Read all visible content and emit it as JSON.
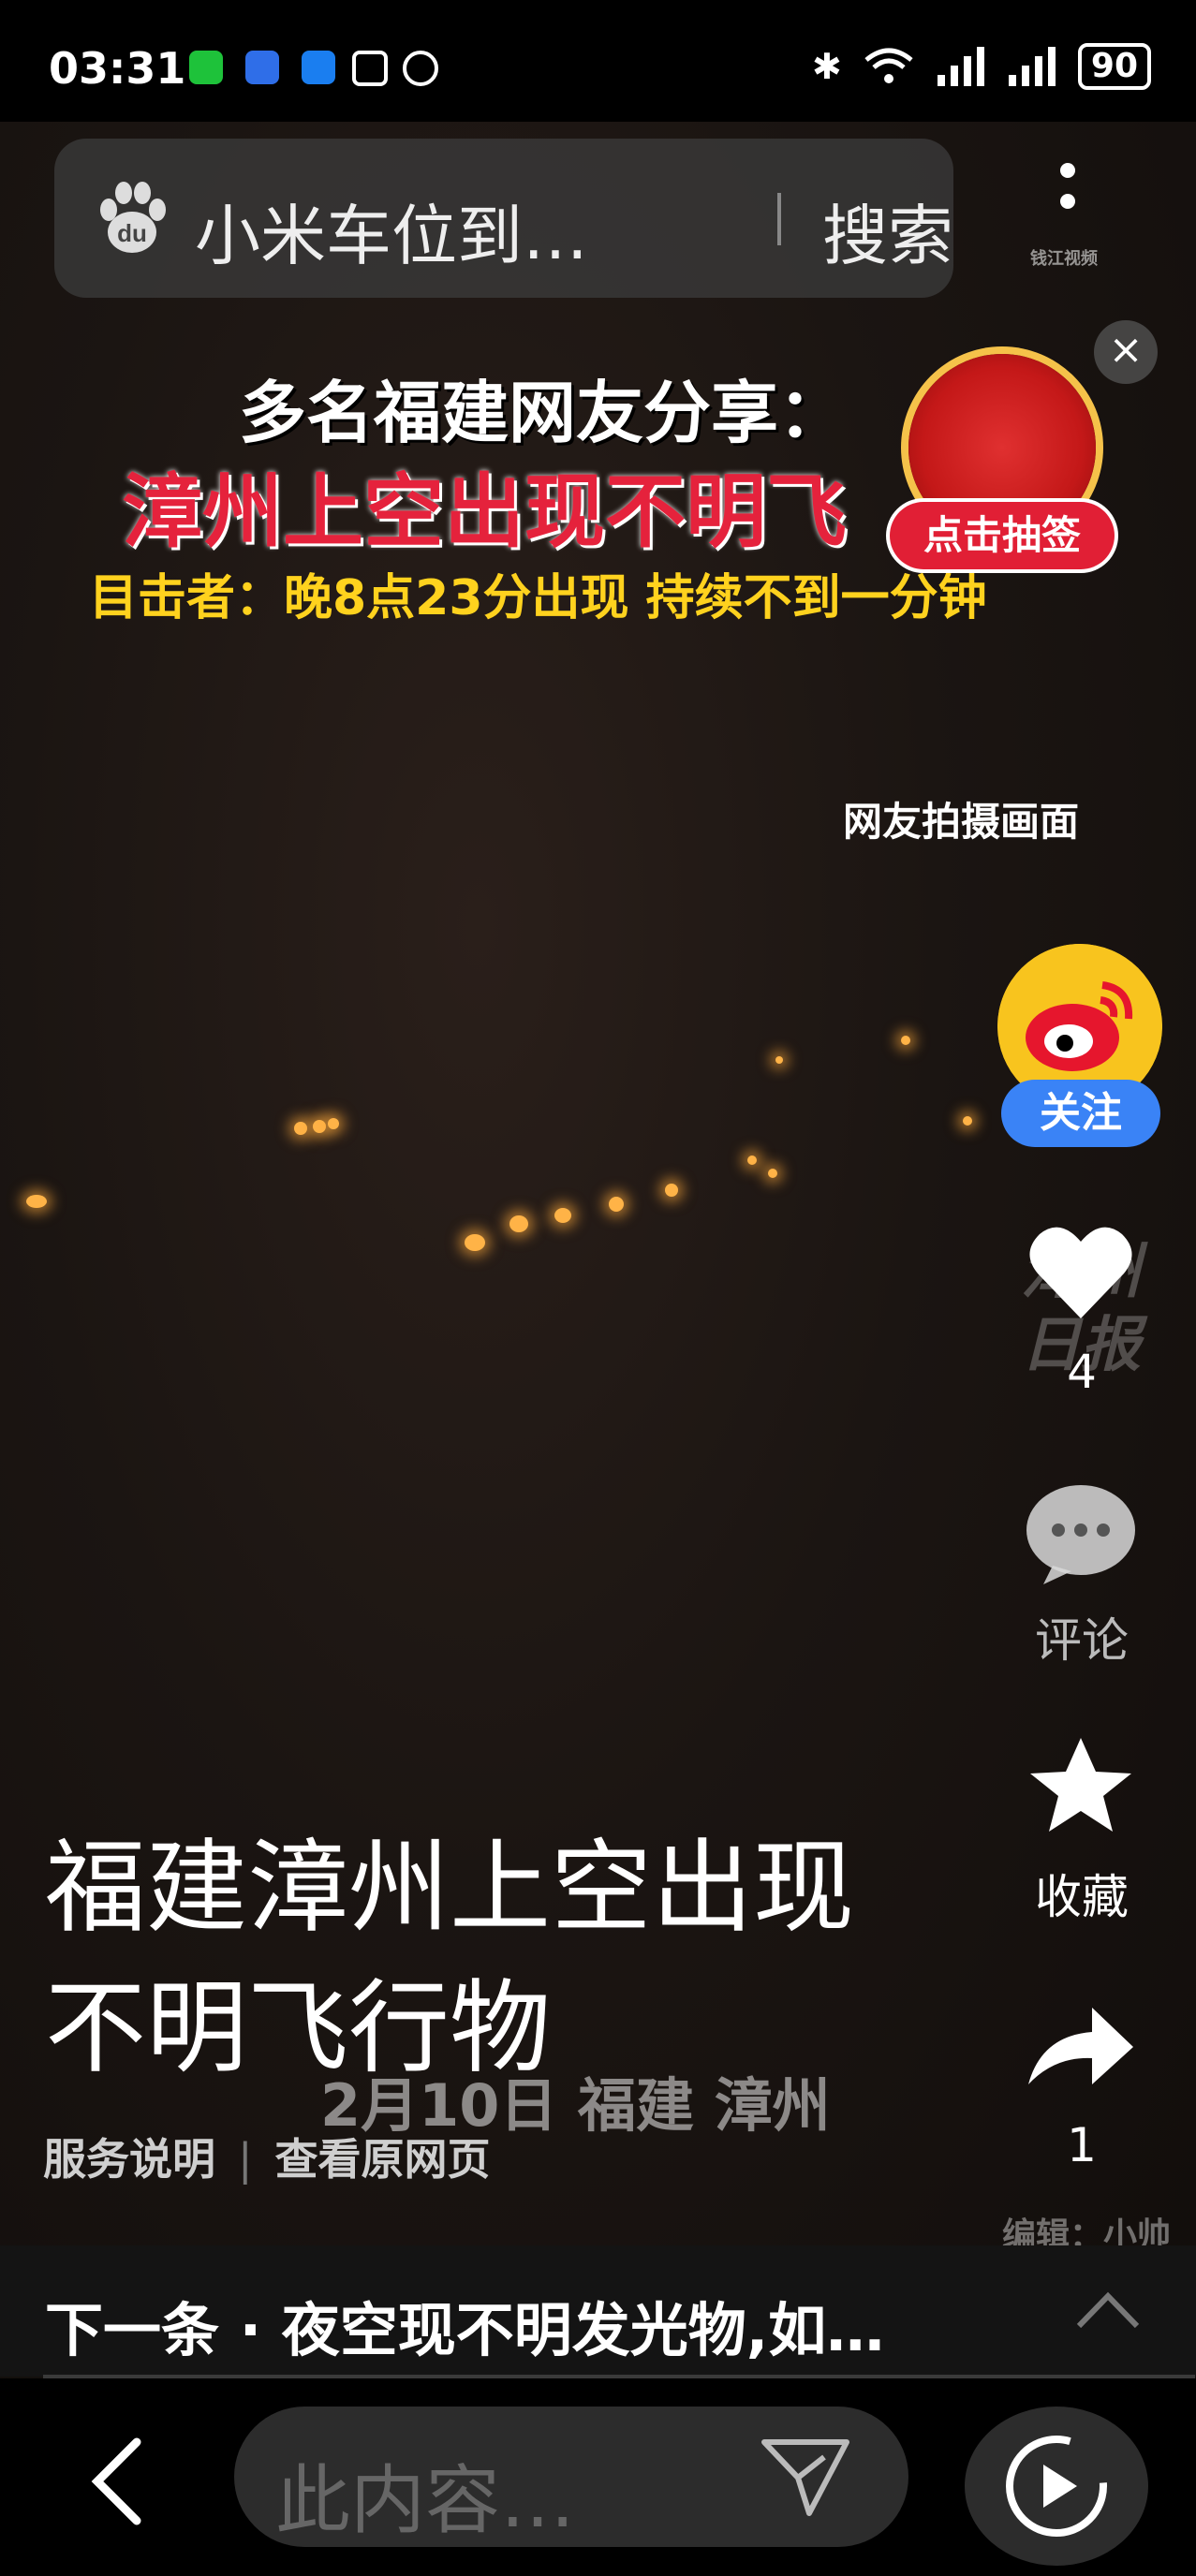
{
  "status_bar": {
    "time": "03:31",
    "battery": "90"
  },
  "search": {
    "query": "小米车位到…",
    "button": "搜索"
  },
  "watermark_top": {
    "brand": "钱江视频"
  },
  "headline": {
    "line1": "多名福建网友分享：",
    "line2": "漳州上空出现不明飞",
    "line3": "目击者：晚8点23分出现 持续不到一分钟"
  },
  "lottery": {
    "label": "点击抽签"
  },
  "video_overlay": {
    "source_label": "网友拍摄画面",
    "date_location": "2月10日 福建 漳州",
    "editor": "编辑：小帅",
    "watermark_mid": [
      "漳州",
      "日报"
    ]
  },
  "sidebar": {
    "follow_label": "关注",
    "like_count": "4",
    "comment_label": "评论",
    "favorite_label": "收藏",
    "share_count": "1"
  },
  "caption": {
    "title": "福建漳州上空出现不明飞行物"
  },
  "links": {
    "service": "服务说明",
    "original": "查看原网页"
  },
  "next": {
    "text": "下一条 · 夜空现不明发光物,如…"
  },
  "bottom": {
    "comment_placeholder": "此内容…"
  },
  "colors": {
    "headline_red": "#e5223c",
    "headline_yellow": "#ffd21e",
    "follow_blue": "#3a83f6",
    "lottery_red": "#e11f35"
  }
}
